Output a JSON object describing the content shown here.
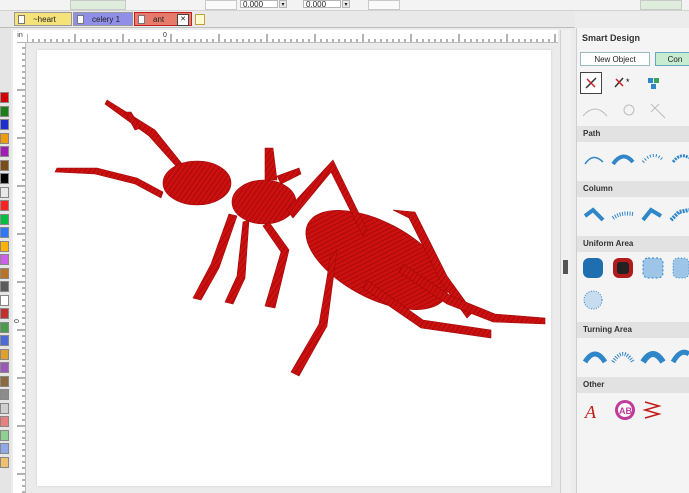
{
  "toolbar": {
    "spin_x": "0.000",
    "spin_y": "0.000"
  },
  "tabs": [
    {
      "label": "~heart",
      "color": "#f6e27a"
    },
    {
      "label": "celery 1",
      "color": "#8f8fe8"
    },
    {
      "label": "ant",
      "color": "#e77b6b",
      "close": "✕"
    }
  ],
  "ruler": {
    "unit": "in",
    "top_zero": "0",
    "left_zero": "0"
  },
  "palette": [
    "#d40000",
    "#1a7f1a",
    "#1b2fd0",
    "#f29b0a",
    "#a01cb5",
    "#7d4b18",
    "#000000",
    "#e8e8e8",
    "#ff2020",
    "#00c040",
    "#2a78ff",
    "#ffb300",
    "#ce5fe8",
    "#b97524",
    "#5b5b5b",
    "#ffffff",
    "#c03030",
    "#4c9a4c",
    "#4c6ad8",
    "#e0a030",
    "#9a58b8",
    "#8b6a3e",
    "#8c8c8c",
    "#cfcfcf",
    "#e88080",
    "#90d090",
    "#90a8e8",
    "#f0c070"
  ],
  "panel": {
    "title": "Smart Design",
    "new_object": "New Object",
    "convert": "Con",
    "sections": [
      {
        "name": "Path"
      },
      {
        "name": "Column"
      },
      {
        "name": "Uniform Area"
      },
      {
        "name": "Turning Area"
      },
      {
        "name": "Other"
      }
    ]
  },
  "colors": {
    "ant": "#cc1010",
    "ant_dark": "#9e0808",
    "accent_blue": "#2f86c9",
    "selected_tab_border": "#c02020"
  }
}
